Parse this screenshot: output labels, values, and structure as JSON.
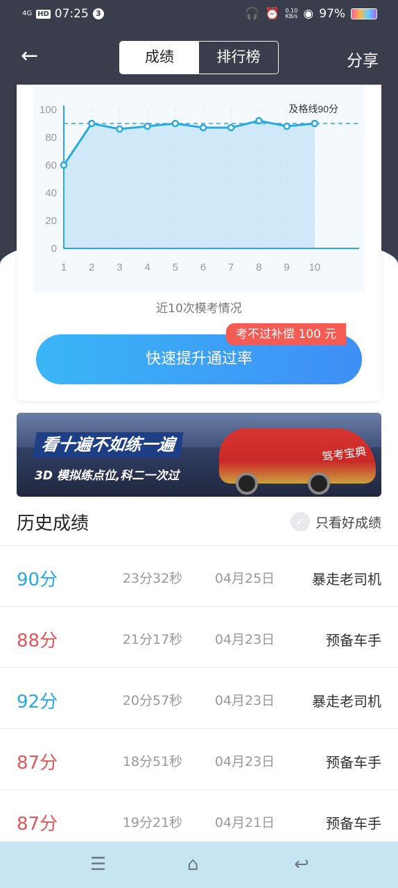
{
  "status_bar": {
    "signal": "4G",
    "hd": "HD",
    "time": "07:25",
    "notification_count": "3",
    "net_speed_value": "0.10",
    "net_speed_unit": "KB/s",
    "battery": "97%"
  },
  "nav": {
    "tabs": [
      {
        "label": "成绩",
        "active": true
      },
      {
        "label": "排行榜",
        "active": false
      }
    ],
    "share_label": "分享"
  },
  "chart_caption": "近10次模考情况",
  "chart_data": {
    "type": "area",
    "x": [
      1,
      2,
      3,
      4,
      5,
      6,
      7,
      8,
      9,
      10
    ],
    "values": [
      60,
      90,
      86,
      88,
      90,
      87,
      87,
      92,
      88,
      90
    ],
    "ylim": [
      0,
      100
    ],
    "yticks": [
      0,
      20,
      40,
      60,
      80,
      100
    ],
    "threshold": 90,
    "threshold_label": "及格线90分",
    "colors": {
      "line": "#2aa8e0",
      "fill": "#bfe3f7",
      "threshold": "#2aa8e0",
      "axis": "#2aa8e0"
    }
  },
  "promo_tag": "考不过补偿 100 元",
  "cta_label": "快速提升通过率",
  "banner": {
    "headline": "看十遍不如练一遍",
    "subline": "3D 模拟练点位,科二一次过",
    "car_text": "驾考宝典"
  },
  "history": {
    "title": "历史成绩",
    "filter_label": "只看好成绩",
    "rows": [
      {
        "score": "90分",
        "time": "23分32秒",
        "date": "04月25日",
        "title": "暴走老司机",
        "color": "#2aa8e0"
      },
      {
        "score": "88分",
        "time": "21分17秒",
        "date": "04月23日",
        "title": "预备车手",
        "color": "#e0585a"
      },
      {
        "score": "92分",
        "time": "20分57秒",
        "date": "04月23日",
        "title": "暴走老司机",
        "color": "#2aa8e0"
      },
      {
        "score": "87分",
        "time": "18分51秒",
        "date": "04月23日",
        "title": "预备车手",
        "color": "#e0585a"
      },
      {
        "score": "87分",
        "time": "19分21秒",
        "date": "04月21日",
        "title": "预备车手",
        "color": "#e0585a"
      }
    ]
  }
}
